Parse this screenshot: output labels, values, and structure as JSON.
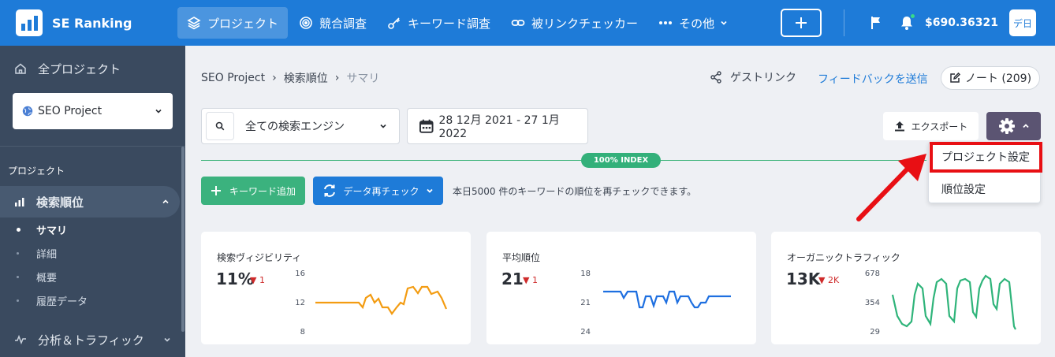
{
  "app": {
    "name": "SE Ranking"
  },
  "topnav": {
    "items": [
      {
        "label": "プロジェクト",
        "icon": "layers-icon",
        "active": true
      },
      {
        "label": "競合調査",
        "icon": "target-icon"
      },
      {
        "label": "キーワード調査",
        "icon": "key-icon"
      },
      {
        "label": "被リンクチェッカー",
        "icon": "link-icon"
      },
      {
        "label": "その他",
        "icon": "dots-icon"
      }
    ],
    "balance": "$690.36321",
    "lang": "デ日"
  },
  "sidebar": {
    "all_projects": "全プロジェクト",
    "project": "SEO Project",
    "section": "プロジェクト",
    "rank": "検索順位",
    "subitems": [
      "サマリ",
      "詳細",
      "概要",
      "履歴データ"
    ],
    "analytics": "分析＆トラフィック"
  },
  "breadcrumb": {
    "root": "SEO Project",
    "sep": "›",
    "mid": "検索順位",
    "current": "サマリ"
  },
  "header": {
    "guest_link": "ゲストリンク",
    "feedback": "フィードバックを送信",
    "notes": "ノート (209)"
  },
  "filters": {
    "engine": "全ての検索エンジン",
    "date_range": "28 12月 2021 - 27 1月 2022"
  },
  "toolbar": {
    "export": "エクスポート"
  },
  "index_label": "100% INDEX",
  "actions": {
    "add_keywords": "キーワード追加",
    "recheck": "データ再チェック",
    "recheck_note": "本日5000 件のキーワードの順位を再チェックできます。"
  },
  "dropdown": {
    "items": [
      "プロジェクト設定",
      "順位設定"
    ]
  },
  "cards": [
    {
      "title": "検索ヴィジビリティ",
      "value": "11%",
      "delta": "1",
      "ticks": [
        "16",
        "12",
        "8"
      ],
      "color": "#f39c12"
    },
    {
      "title": "平均順位",
      "value": "21",
      "delta": "1",
      "ticks": [
        "18",
        "21",
        "24"
      ],
      "color": "#1e6fe0"
    },
    {
      "title": "オーガニックトラフィック",
      "value": "13K",
      "delta": "2K",
      "ticks": [
        "678",
        "354",
        "29"
      ],
      "color": "#2fb47a"
    }
  ],
  "colors": {
    "brand": "#1e7bd8",
    "sidebar": "#3a4a5f",
    "success": "#3bb27e",
    "highlight": "#e80f14",
    "down": "#cf2b2b"
  }
}
